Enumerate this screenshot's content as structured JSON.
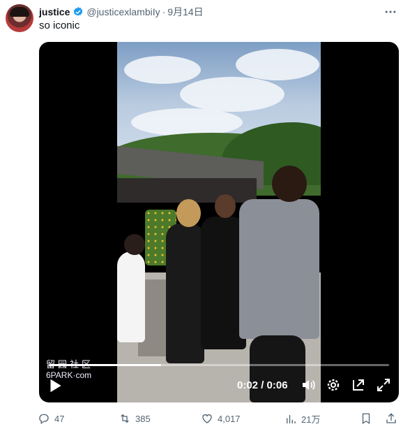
{
  "tweet": {
    "display_name": "justice",
    "handle": "@justicexlambiIy",
    "separator": "·",
    "date": "9月14日",
    "text": "so iconic",
    "more_icon": "ellipsis-icon"
  },
  "video": {
    "current_time": "0:02",
    "separator": "/",
    "duration": "0:06",
    "progress_fraction": 0.33,
    "watermark_line1": "留园社区",
    "watermark_line2": "6PARK·com"
  },
  "actions": {
    "replies": "47",
    "retweets": "385",
    "likes": "4,017",
    "views": "21万"
  },
  "colors": {
    "verified_blue": "#1d9bf0",
    "secondary_text": "#536471"
  }
}
